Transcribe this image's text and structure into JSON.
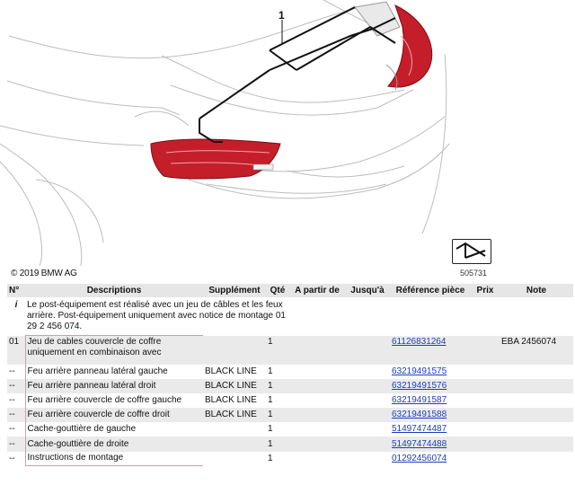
{
  "diagram": {
    "copyright": "© 2019 BMW AG",
    "callout_number": "1",
    "image_ref": "505731"
  },
  "table": {
    "headers": {
      "no": "N°",
      "description": "Descriptions",
      "supplement": "Supplément",
      "qty": "Qté",
      "from": "A partir de",
      "to": "Jusqu'à",
      "part_ref": "Référence pièce",
      "price": "Prix",
      "note": "Note"
    },
    "info": {
      "marker": "i",
      "text": "Le post-équipement est réalisé avec un jeu de câbles et les feux arrière. Post-équipement uniquement avec notice de montage 01 29 2 456 074."
    },
    "rows": [
      {
        "no": "01",
        "description": "Jeu de cables couvercle de coffre uniquement en combinaison avec",
        "supplement": "",
        "qty": "1",
        "part_ref": "61126831264",
        "note": "EBA 2456074"
      },
      {
        "no": "--",
        "description": "Feu arrière panneau latéral gauche",
        "supplement": "BLACK LINE",
        "qty": "1",
        "part_ref": "63219491575",
        "note": ""
      },
      {
        "no": "--",
        "description": "Feu arrière panneau latéral droit",
        "supplement": "BLACK LINE",
        "qty": "1",
        "part_ref": "63219491576",
        "note": ""
      },
      {
        "no": "--",
        "description": "Feu arrière couvercle de coffre gauche",
        "supplement": "BLACK LINE",
        "qty": "1",
        "part_ref": "63219491587",
        "note": ""
      },
      {
        "no": "--",
        "description": "Feu arrière couvercle de coffre droit",
        "supplement": "BLACK LINE",
        "qty": "1",
        "part_ref": "63219491588",
        "note": ""
      },
      {
        "no": "--",
        "description": "Cache-gouttière de gauche",
        "supplement": "",
        "qty": "1",
        "part_ref": "51497474487",
        "note": ""
      },
      {
        "no": "--",
        "description": "Cache-gouttière de droite",
        "supplement": "",
        "qty": "1",
        "part_ref": "51497474488",
        "note": ""
      },
      {
        "no": "--",
        "description": "Instructions de montage",
        "supplement": "",
        "qty": "1",
        "part_ref": "01292456074",
        "note": ""
      }
    ]
  },
  "colors": {
    "taillight_red": "#c41e2a",
    "link": "#1a3fbf",
    "header_bg": "#e6e6e6",
    "shade_bg": "#eaeaea"
  }
}
